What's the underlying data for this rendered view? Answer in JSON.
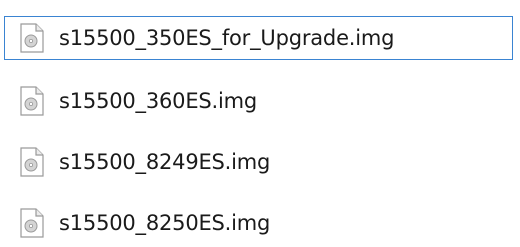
{
  "files": [
    {
      "name": "s15500_350ES_for_Upgrade.img",
      "icon": "disc-image-file-icon",
      "selected": true
    },
    {
      "name": "s15500_360ES.img",
      "icon": "disc-image-file-icon",
      "selected": false
    },
    {
      "name": "s15500_8249ES.img",
      "icon": "disc-image-file-icon",
      "selected": false
    },
    {
      "name": "s15500_8250ES.img",
      "icon": "disc-image-file-icon",
      "selected": false
    }
  ],
  "colors": {
    "selection_border": "#3a84d2",
    "text": "#1a1a1a"
  }
}
